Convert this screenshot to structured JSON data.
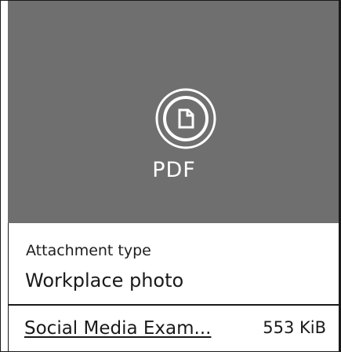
{
  "preview": {
    "icon": "pdf-file-icon",
    "file_type": "PDF",
    "background_color": "#6f6f6f"
  },
  "details": {
    "type_label": "Attachment type",
    "type_value": "Workplace photo"
  },
  "file": {
    "name": "Social Media Exam...",
    "size": "553 KiB"
  }
}
